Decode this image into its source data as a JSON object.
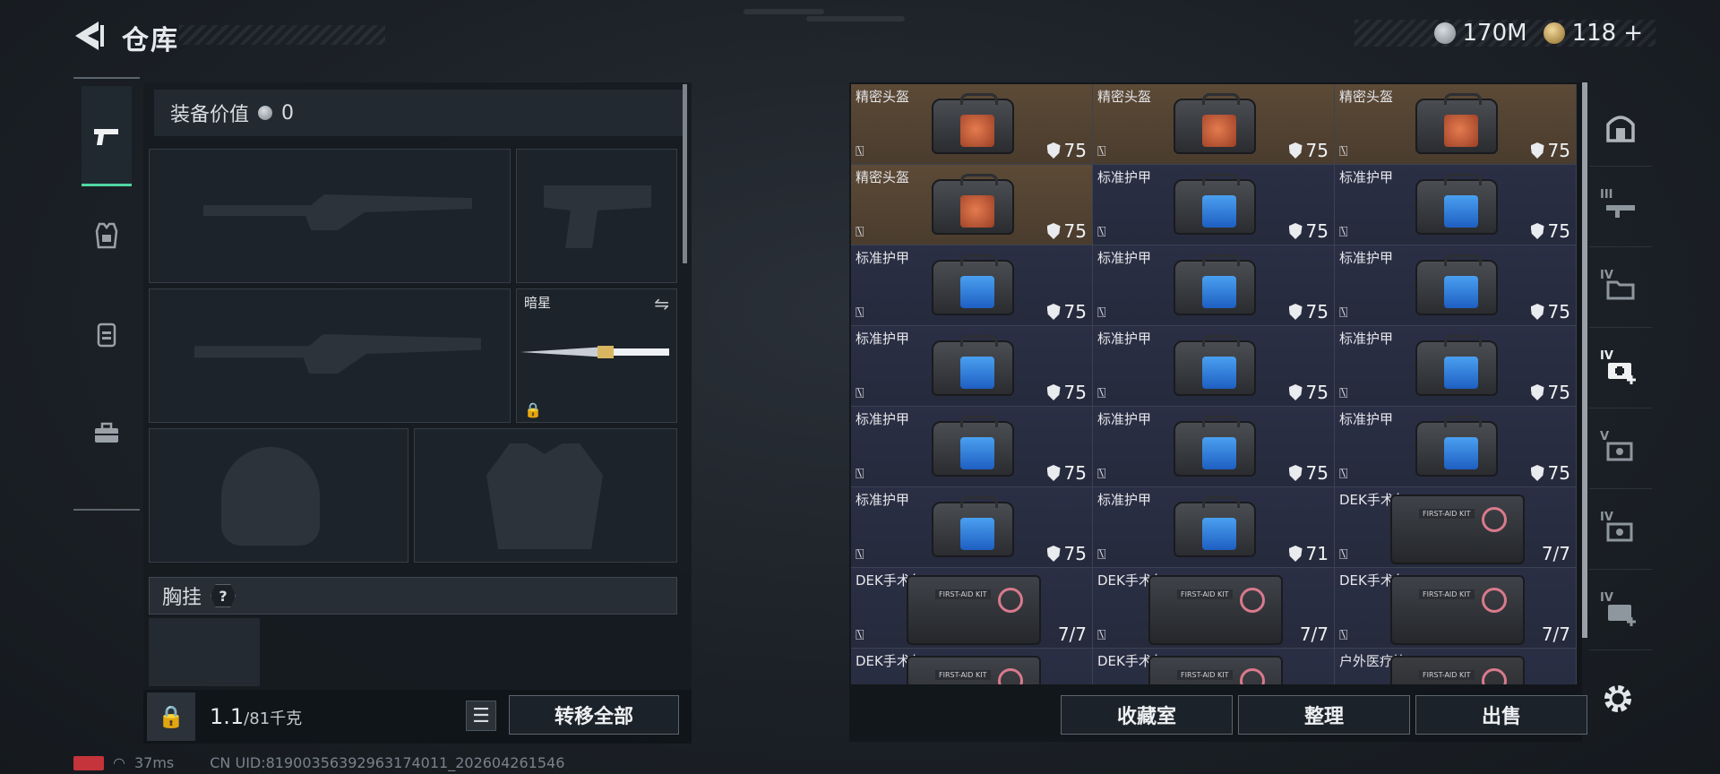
{
  "header": {
    "title": "仓库"
  },
  "currency": {
    "silver": "170M",
    "gold": "118",
    "gold_plus": "+"
  },
  "equipment": {
    "value_label": "装备价值",
    "value": "0",
    "knife_name": "暗星",
    "chest_label": "胸挂",
    "help": "?",
    "weight_value": "1.1",
    "weight_cap": "/81千克",
    "transfer_all": "转移全部"
  },
  "storage": {
    "items": [
      {
        "name": "精密头盔",
        "kind": "helmet",
        "durability": "75"
      },
      {
        "name": "精密头盔",
        "kind": "helmet",
        "durability": "75"
      },
      {
        "name": "精密头盔",
        "kind": "helmet",
        "durability": "75"
      },
      {
        "name": "精密头盔",
        "kind": "helmet",
        "durability": "75"
      },
      {
        "name": "标准护甲",
        "kind": "armor",
        "durability": "75"
      },
      {
        "name": "标准护甲",
        "kind": "armor",
        "durability": "75"
      },
      {
        "name": "标准护甲",
        "kind": "armor",
        "durability": "75"
      },
      {
        "name": "标准护甲",
        "kind": "armor",
        "durability": "75"
      },
      {
        "name": "标准护甲",
        "kind": "armor",
        "durability": "75"
      },
      {
        "name": "标准护甲",
        "kind": "armor",
        "durability": "75"
      },
      {
        "name": "标准护甲",
        "kind": "armor",
        "durability": "75"
      },
      {
        "name": "标准护甲",
        "kind": "armor",
        "durability": "75"
      },
      {
        "name": "标准护甲",
        "kind": "armor",
        "durability": "75"
      },
      {
        "name": "标准护甲",
        "kind": "armor",
        "durability": "75"
      },
      {
        "name": "标准护甲",
        "kind": "armor",
        "durability": "75"
      },
      {
        "name": "标准护甲",
        "kind": "armor",
        "durability": "75"
      },
      {
        "name": "标准护甲",
        "kind": "armor",
        "durability": "71"
      },
      {
        "name": "DEK手术包",
        "kind": "medkit",
        "count": "7/7"
      },
      {
        "name": "DEK手术包",
        "kind": "medkit",
        "count": "7/7"
      },
      {
        "name": "DEK手术包",
        "kind": "medkit",
        "count": "7/7"
      },
      {
        "name": "DEK手术包",
        "kind": "medkit",
        "count": "7/7"
      },
      {
        "name": "DEK手术包",
        "kind": "medkit",
        "count": ""
      },
      {
        "name": "DEK手术包",
        "kind": "medkit",
        "count": ""
      },
      {
        "name": "户外医疗箱",
        "kind": "medbox",
        "count": ""
      }
    ],
    "actions": {
      "collection": "收藏室",
      "organize": "整理",
      "sell": "出售"
    }
  },
  "categories": [
    "all",
    "III",
    "IV",
    "IV",
    "V",
    "IV",
    "IV"
  ],
  "status": {
    "ping": "37ms",
    "uid": "CN UID:81900356392963174011_202604261546"
  }
}
